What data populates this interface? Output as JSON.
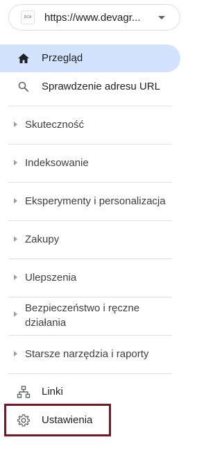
{
  "property": {
    "favicon_text": "DCA",
    "url": "https://www.devagr..."
  },
  "nav_top": [
    {
      "label": "Przegląd",
      "icon": "home-icon",
      "selected": true
    },
    {
      "label": "Sprawdzenie adresu URL",
      "icon": "search-icon",
      "selected": false
    }
  ],
  "sections": [
    {
      "label": "Skuteczność"
    },
    {
      "label": "Indeksowanie"
    },
    {
      "label": "Eksperymenty i personalizacja"
    },
    {
      "label": "Zakupy"
    },
    {
      "label": "Ulepszenia"
    },
    {
      "label": "Bezpieczeństwo i ręczne działania"
    },
    {
      "label": "Starsze narzędzia i raporty"
    }
  ],
  "nav_bottom": [
    {
      "label": "Linki",
      "icon": "sitemap-icon"
    },
    {
      "label": "Ustawienia",
      "icon": "gear-icon"
    }
  ],
  "colors": {
    "selected_bg": "#d3e3fd",
    "highlight_border": "#7b1423"
  }
}
